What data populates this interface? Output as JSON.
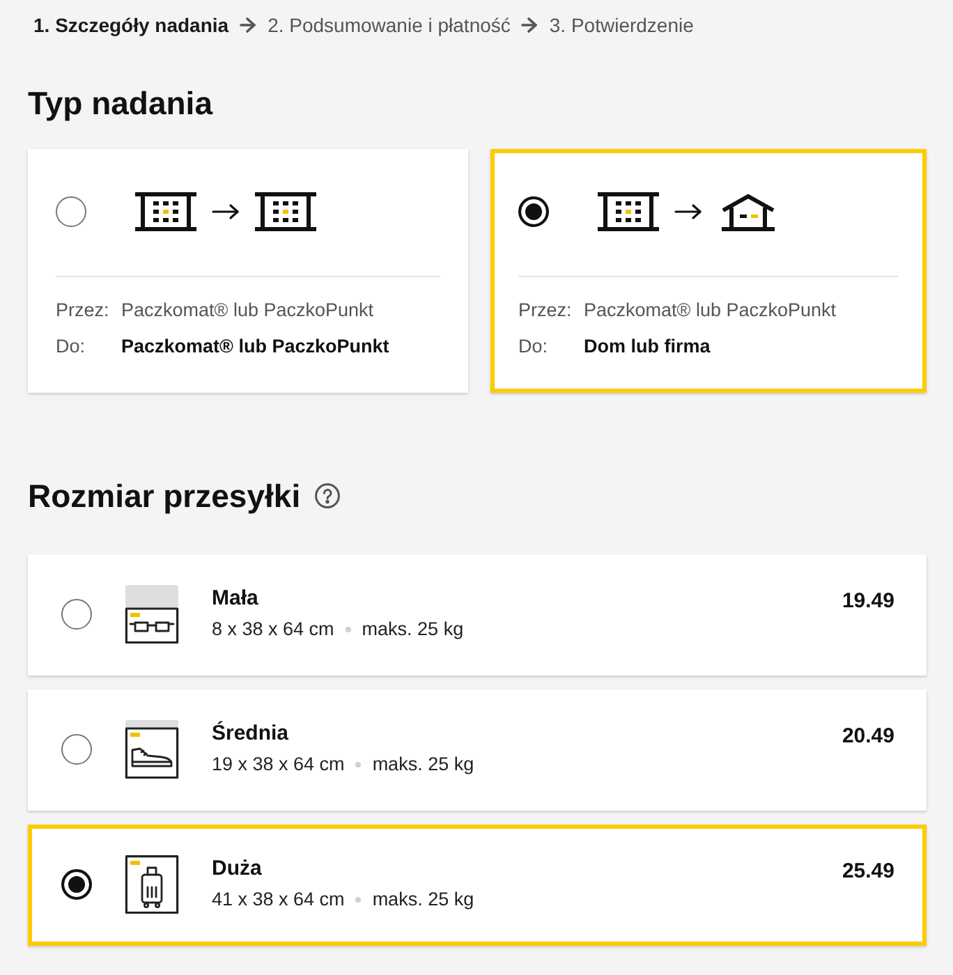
{
  "steps": [
    {
      "label": "1. Szczegóły nadania",
      "selected": true
    },
    {
      "label": "2. Podsumowanie i płatność",
      "selected": false
    },
    {
      "label": "3. Potwierdzenie",
      "selected": false
    }
  ],
  "shipping_type": {
    "title": "Typ nadania",
    "options": [
      {
        "route": [
          {
            "kind": "locker"
          },
          {
            "kind": "locker"
          }
        ],
        "via_label": "Przez:",
        "via": "Paczkomat® lub PaczkoPunkt",
        "to_label": "Do:",
        "to": "Paczkomat® lub PaczkoPunkt",
        "selected": false
      },
      {
        "route": [
          {
            "kind": "locker"
          },
          {
            "kind": "house"
          }
        ],
        "via_label": "Przez:",
        "via": "Paczkomat® lub PaczkoPunkt",
        "to_label": "Do:",
        "to": "Dom lub firma",
        "selected": true
      }
    ]
  },
  "parcel_size": {
    "title": "Rozmiar przesyłki",
    "options": [
      {
        "kind": "small",
        "name": "Mała",
        "dimensions": "8 x 38 x 64 cm",
        "max_weight": "maks. 25 kg",
        "price": "19.49",
        "selected": false
      },
      {
        "kind": "medium",
        "name": "Średnia",
        "dimensions": "19 x 38 x 64 cm",
        "max_weight": "maks. 25 kg",
        "price": "20.49",
        "selected": false
      },
      {
        "kind": "large",
        "name": "Duża",
        "dimensions": "41 x 38 x 64 cm",
        "max_weight": "maks. 25 kg",
        "price": "25.49",
        "selected": true
      }
    ]
  }
}
